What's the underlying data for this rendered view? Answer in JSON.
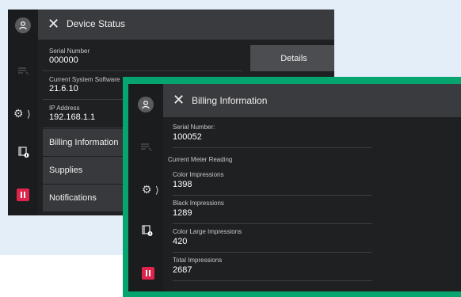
{
  "device_status": {
    "title": "Device Status",
    "details_label": "Details",
    "fields": [
      {
        "label": "Serial Number",
        "value": "000000"
      },
      {
        "label": "Current System Software",
        "value": "21.6.10"
      },
      {
        "label": "IP Address",
        "value": "192.168.1.1"
      }
    ],
    "nav_items": [
      "Billing Information",
      "Supplies",
      "Notifications"
    ]
  },
  "billing": {
    "title": "Billing Information",
    "serial_label": "Serial Number:",
    "serial_value": "100052",
    "section_label": "Current Meter Reading",
    "meters": [
      {
        "label": "Color Impressions",
        "value": "1398"
      },
      {
        "label": "Black Impressions",
        "value": "1289"
      },
      {
        "label": "Color Large Impressions",
        "value": "420"
      },
      {
        "label": "Total Impressions",
        "value": "2687"
      }
    ]
  },
  "colors": {
    "highlight_frame": "#06a56f",
    "pause_button": "#e0234a",
    "background_panel": "#e3eef8"
  },
  "icons": [
    "user-icon",
    "job-status-icon",
    "gear-icon",
    "chevron-right-icon",
    "printer-info-icon",
    "pause-icon",
    "close-icon"
  ]
}
